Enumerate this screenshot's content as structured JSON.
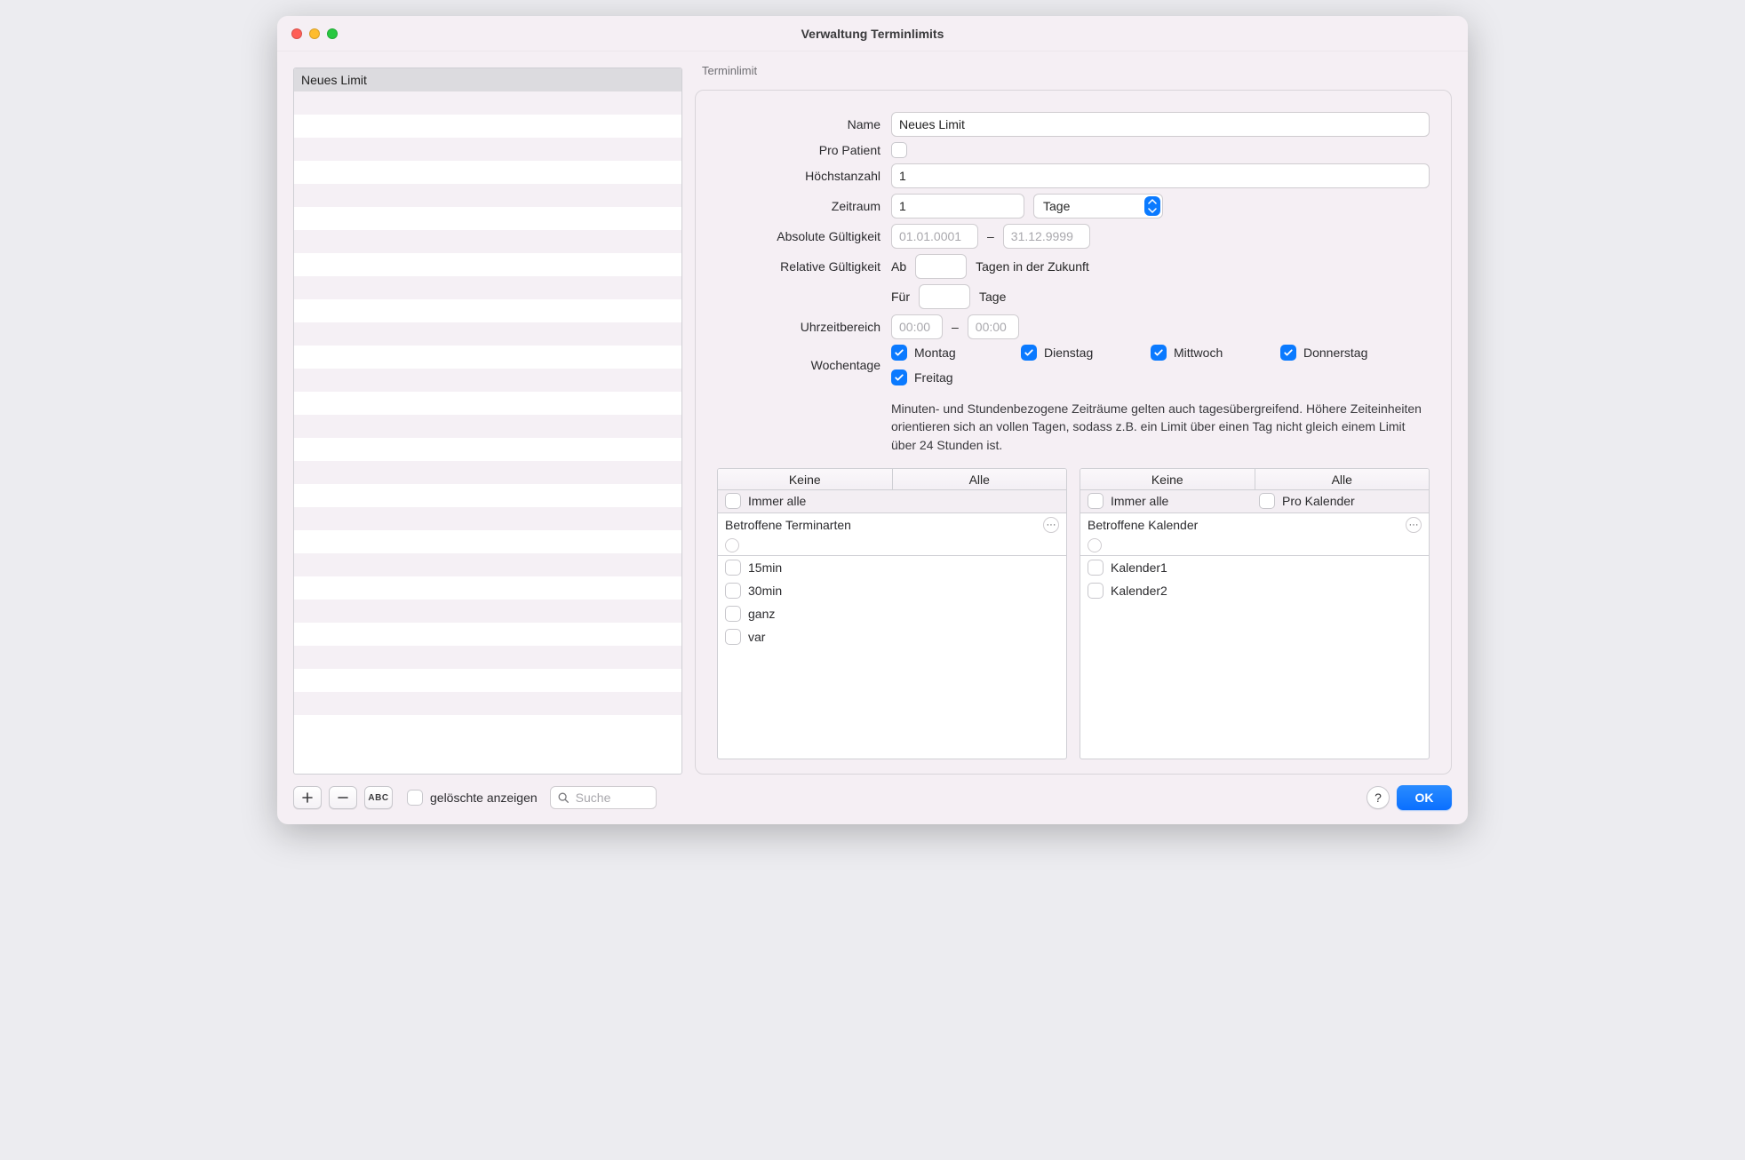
{
  "window": {
    "title": "Verwaltung Terminlimits"
  },
  "sidebar": {
    "items": [
      {
        "label": "Neues Limit",
        "selected": true
      }
    ],
    "row_count": 29
  },
  "form": {
    "group_label": "Terminlimit",
    "labels": {
      "name": "Name",
      "pro_patient": "Pro Patient",
      "hoechstanzahl": "Höchstanzahl",
      "zeitraum": "Zeitraum",
      "absolute": "Absolute Gültigkeit",
      "relative": "Relative Gültigkeit",
      "uhrzeit": "Uhrzeitbereich",
      "wochentage": "Wochentage"
    },
    "values": {
      "name": "Neues Limit",
      "pro_patient": false,
      "hoechstanzahl": "1",
      "zeitraum_value": "1",
      "zeitraum_unit": "Tage",
      "absolute_from_placeholder": "01.01.0001",
      "absolute_to_placeholder": "31.12.9999",
      "relative_ab_prefix": "Ab",
      "relative_ab_value": "",
      "relative_ab_suffix": "Tagen in der Zukunft",
      "relative_fuer_prefix": "Für",
      "relative_fuer_value": "",
      "relative_fuer_suffix": "Tage",
      "time_from_placeholder": "00:00",
      "time_to_placeholder": "00:00",
      "days": [
        {
          "label": "Montag",
          "checked": true
        },
        {
          "label": "Dienstag",
          "checked": true
        },
        {
          "label": "Mittwoch",
          "checked": true
        },
        {
          "label": "Donnerstag",
          "checked": true
        },
        {
          "label": "Freitag",
          "checked": true
        }
      ]
    },
    "help_text": "Minuten- und Stundenbezogene Zeiträume gelten auch tagesübergreifend. Höhere Zeiteinheiten orientieren sich an vollen Tagen, sodass z.B. ein Limit über einen Tag nicht gleich einem Limit über 24 Stunden ist.",
    "dash": "–"
  },
  "panels": {
    "segments": {
      "none": "Keine",
      "all": "Alle"
    },
    "left": {
      "immer_alle": {
        "label": "Immer alle",
        "checked": false
      },
      "heading": "Betroffene Terminarten",
      "items": [
        {
          "label": "15min",
          "checked": false
        },
        {
          "label": "30min",
          "checked": false
        },
        {
          "label": "ganz",
          "checked": false
        },
        {
          "label": "var",
          "checked": false
        }
      ]
    },
    "right": {
      "immer_alle": {
        "label": "Immer alle",
        "checked": false
      },
      "pro_kalender": {
        "label": "Pro Kalender",
        "checked": false
      },
      "heading": "Betroffene Kalender",
      "items": [
        {
          "label": "Kalender1",
          "checked": false
        },
        {
          "label": "Kalender2",
          "checked": false
        }
      ]
    }
  },
  "footer": {
    "abc": "ABC",
    "show_deleted": {
      "label": "gelöschte anzeigen",
      "checked": false
    },
    "search_placeholder": "Suche",
    "help_label": "?",
    "ok_label": "OK"
  }
}
